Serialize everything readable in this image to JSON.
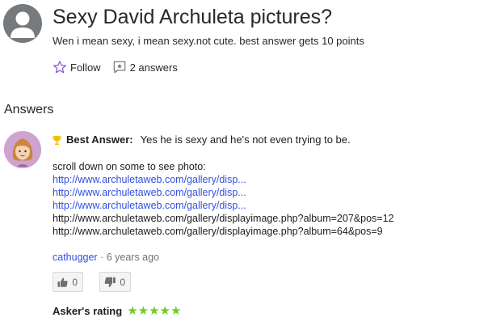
{
  "question": {
    "title": "Sexy David Archuleta pictures?",
    "details": "Wen i mean sexy, i mean sexy.not cute. best answer gets 10 points",
    "follow_label": "Follow",
    "answers_label": "2 answers"
  },
  "answers_heading": "Answers",
  "best_answer": {
    "label": "Best Answer:",
    "text": "Yes he is sexy and he's not even trying to be.",
    "intro": "scroll down on some to see photo:",
    "links": [
      "http://www.archuletaweb.com/gallery/disp...",
      "http://www.archuletaweb.com/gallery/disp...",
      "http://www.archuletaweb.com/gallery/disp..."
    ],
    "plain_urls": [
      "http://www.archuletaweb.com/gallery/displayimage.php?album=207&pos=12",
      "http://www.archuletaweb.com/gallery/displayimage.php?album=64&pos=9"
    ],
    "author": "cathugger",
    "age": " · 6 years ago",
    "thumbs_up": "0",
    "thumbs_down": "0",
    "askers_rating_label": "Asker's rating",
    "askers_rating": 5,
    "stars": "★★★★★"
  },
  "colors": {
    "link": "#324fe1",
    "follow_star": "#8b4fd8",
    "rating_stars": "#6fcb27",
    "trophy": "#f0c000"
  }
}
